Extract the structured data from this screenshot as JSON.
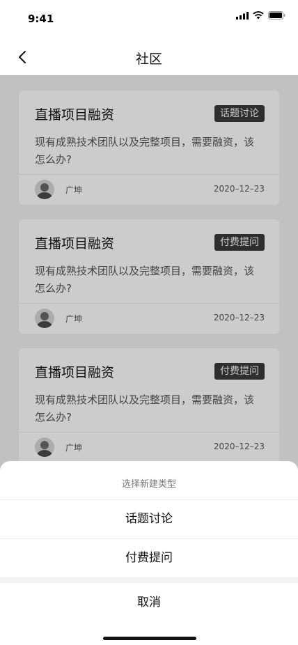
{
  "status": {
    "time": "9:41"
  },
  "nav": {
    "title": "社区"
  },
  "posts": [
    {
      "title": "直播项目融资",
      "tag": "话题讨论",
      "body": "现有成熟技术团队以及完整项目，需要融资，该怎么办?",
      "author": "广坤",
      "date": "2020–12–23"
    },
    {
      "title": "直播项目融资",
      "tag": "付费提问",
      "body": "现有成熟技术团队以及完整项目，需要融资，该怎么办?",
      "author": "广坤",
      "date": "2020–12–23"
    },
    {
      "title": "直播项目融资",
      "tag": "付费提问",
      "body": "现有成熟技术团队以及完整项目，需要融资，该怎么办?",
      "author": "广坤",
      "date": "2020–12–23"
    }
  ],
  "sheet": {
    "title": "选择新建类型",
    "options": [
      "话题讨论",
      "付费提问"
    ],
    "cancel": "取消"
  }
}
